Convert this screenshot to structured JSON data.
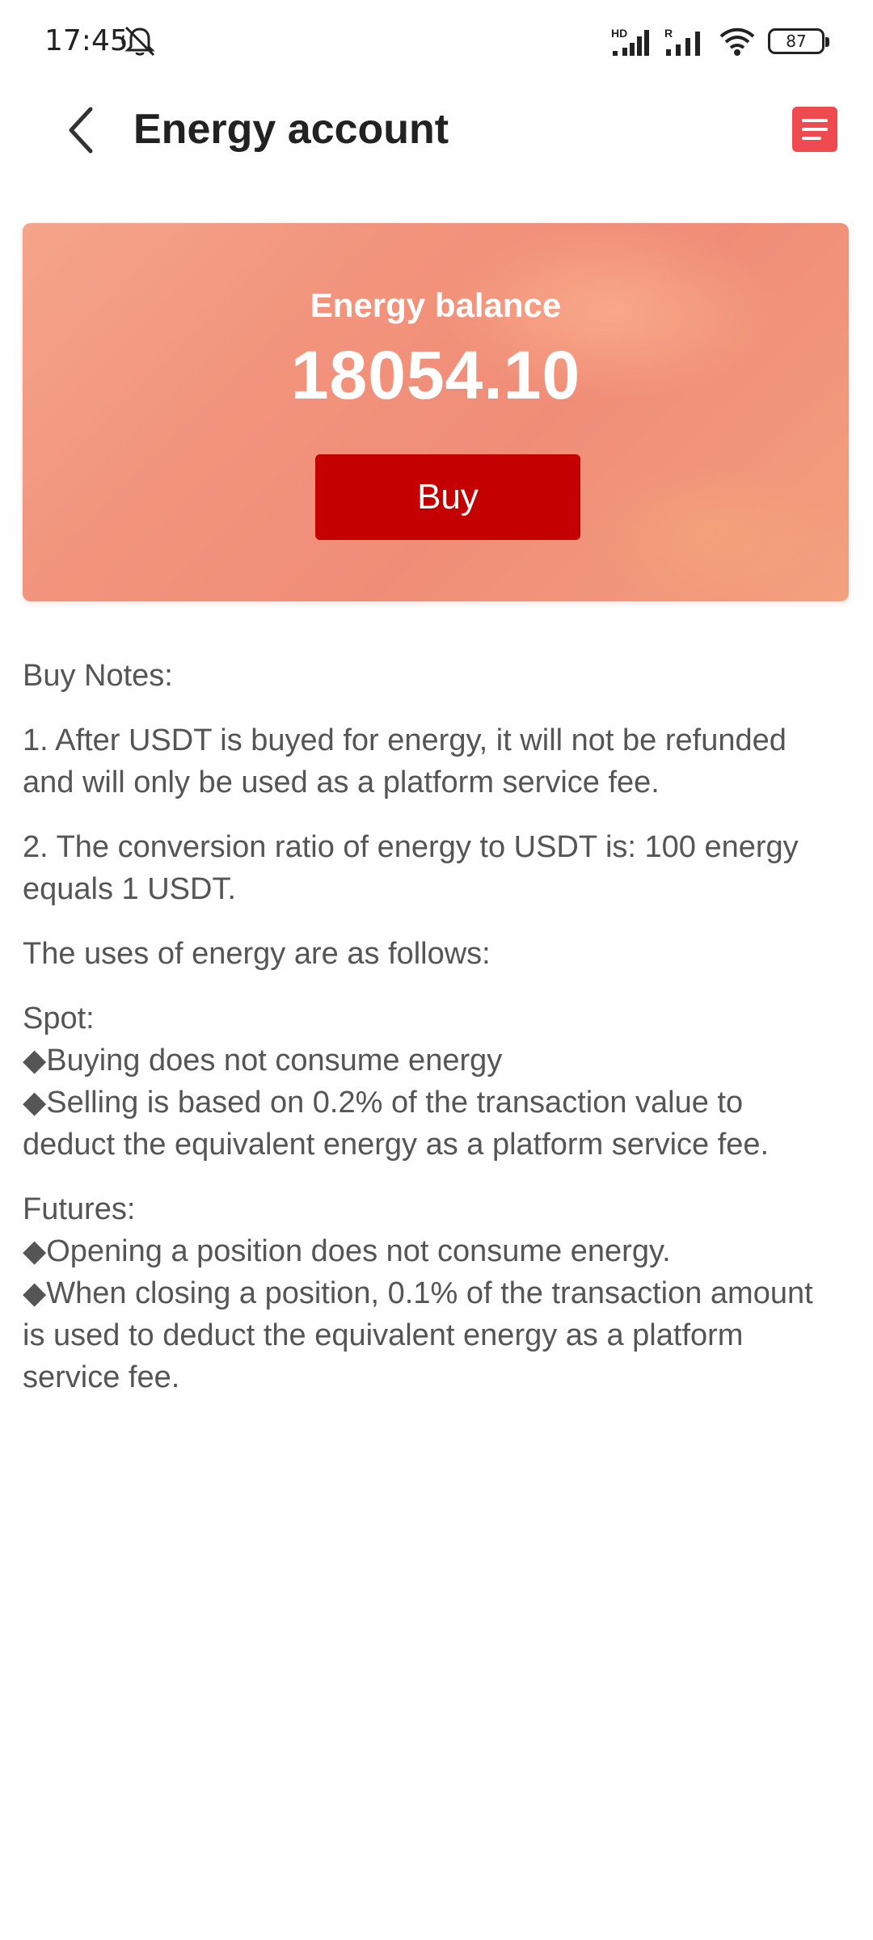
{
  "status_bar": {
    "time": "17:45",
    "signal1_tag": "HD",
    "signal2_tag": "R",
    "battery": "87"
  },
  "header": {
    "title": "Energy account"
  },
  "balance_card": {
    "label": "Energy balance",
    "value": "18054.10",
    "buy_label": "Buy"
  },
  "notes": {
    "heading": "Buy Notes:",
    "note1": "1. After USDT is buyed for energy, it will not be refunded and will only be used as a platform service fee.",
    "note2": "2. The conversion ratio of energy to USDT is: 100 energy equals 1 USDT.",
    "uses_heading": "The uses of energy are as follows:",
    "spot_heading": "Spot:",
    "spot_item1": "◆Buying does not consume energy",
    "spot_item2": "◆Selling is based on 0.2% of the transaction value to deduct the equivalent energy as a platform service fee.",
    "futures_heading": "Futures:",
    "futures_item1": "◆Opening a position does not consume energy.",
    "futures_item2": "◆When closing a position, 0.1% of the transaction amount is used to deduct the equivalent energy as a platform service fee."
  },
  "colors": {
    "accent": "#c40000",
    "menu": "#ef4a4f",
    "card": "#f2937c"
  }
}
